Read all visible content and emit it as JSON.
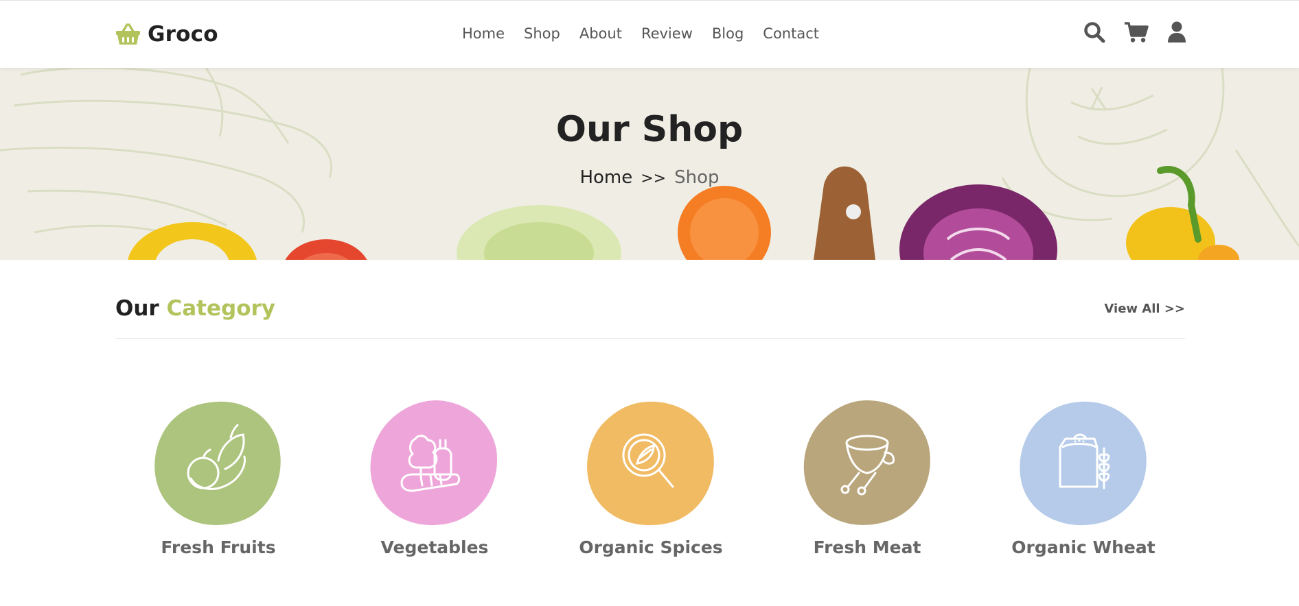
{
  "header": {
    "brand": "Groco",
    "nav": [
      "Home",
      "Shop",
      "About",
      "Review",
      "Blog",
      "Contact"
    ],
    "icons": [
      "search-icon",
      "cart-icon",
      "user-icon"
    ],
    "accent_color": "#b3c35c"
  },
  "banner": {
    "title": "Our Shop",
    "breadcrumb_home": "Home",
    "breadcrumb_sep": ">>",
    "breadcrumb_current": "Shop"
  },
  "category": {
    "title_part1": "Our",
    "title_part2": "Category",
    "view_all": "View All >>",
    "items": [
      {
        "label": "Fresh Fruits",
        "icon": "fruits-icon",
        "color": "#adc47e"
      },
      {
        "label": "Vegetables",
        "icon": "vegetables-icon",
        "color": "#eea6da"
      },
      {
        "label": "Organic Spices",
        "icon": "spices-icon",
        "color": "#f1bb64"
      },
      {
        "label": "Fresh Meat",
        "icon": "meat-icon",
        "color": "#b9a67c"
      },
      {
        "label": "Organic Wheat",
        "icon": "wheat-icon",
        "color": "#b5cbe9"
      }
    ]
  }
}
